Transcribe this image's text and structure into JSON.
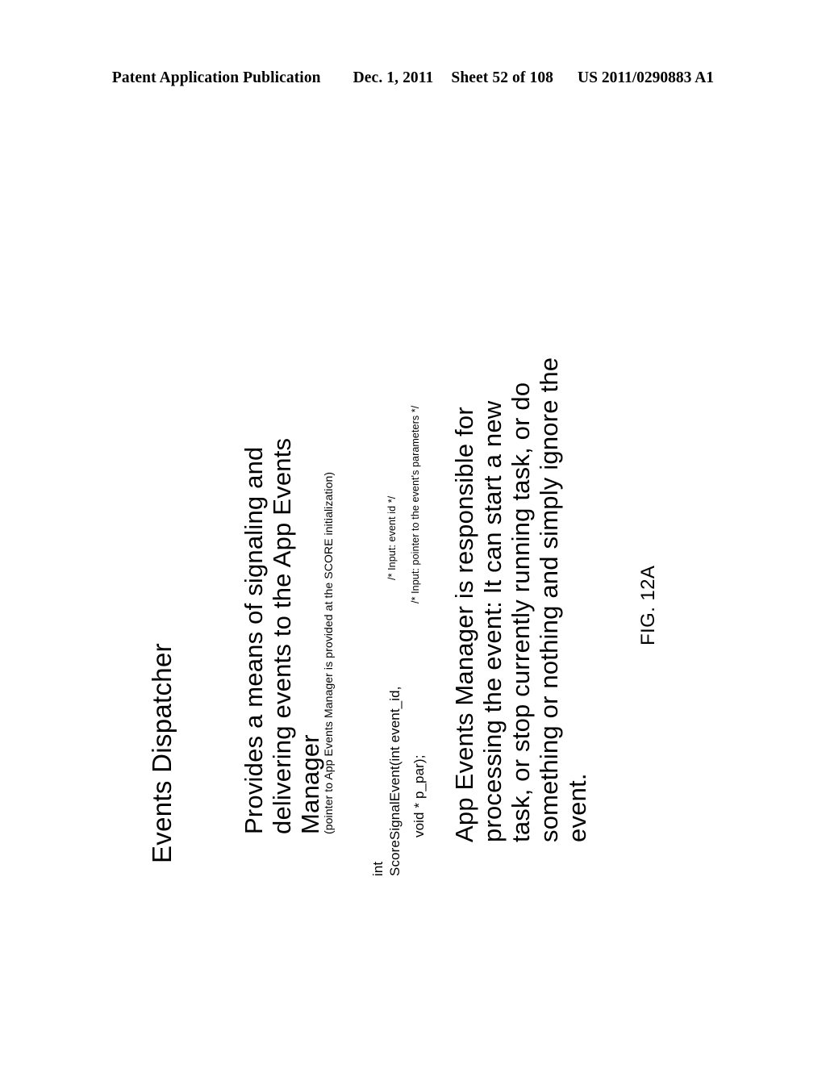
{
  "header": {
    "publication": "Patent Application Publication",
    "date": "Dec. 1, 2011",
    "sheet": "Sheet 52 of 108",
    "patent_number": "US 2011/0290883 A1"
  },
  "figure": {
    "caption": "FIG. 12A",
    "heading": "Events Dispatcher",
    "paragraph_1": [
      "Provides a means of signaling and",
      "delivering events to the App Events",
      "Manager"
    ],
    "note": "(pointer to App Events Manager is provided at the SCORE initialization)",
    "code": {
      "return_type": "int",
      "signature": "ScoreSignalEvent(int event_id,",
      "param_2": "void * p_par);",
      "comment_1": "/* Input:  event id */",
      "comment_2": "/* Input:  pointer to the event's parameters */"
    },
    "paragraph_2": [
      "App Events Manager is responsible for",
      "processing the event:  It can start a new",
      "task, or stop currently running task, or do",
      "something or nothing and simply ignore the",
      "event."
    ]
  }
}
